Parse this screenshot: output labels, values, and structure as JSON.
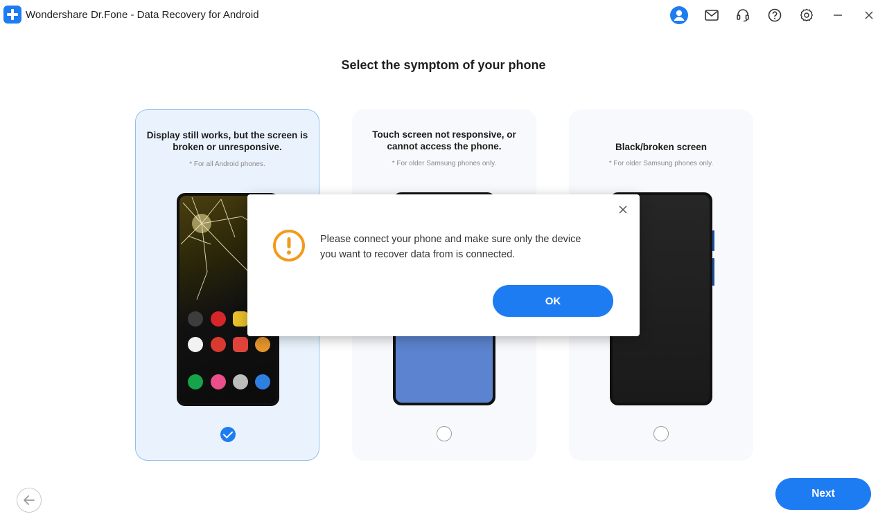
{
  "window": {
    "title": "Wondershare Dr.Fone - Data Recovery for Android",
    "icons": [
      "account-icon",
      "mail-icon",
      "headset-icon",
      "help-icon",
      "settings-icon",
      "minimize-icon",
      "close-icon"
    ]
  },
  "page": {
    "title": "Select the symptom of your phone"
  },
  "cards": [
    {
      "title": "Display still works, but the screen is broken or unresponsive.",
      "note": "* For all Android phones.",
      "selected": true
    },
    {
      "title": "Touch screen not responsive, or cannot access the phone.",
      "note": "* For older Samsung phones only.",
      "selected": false
    },
    {
      "title": "Black/broken screen",
      "note": "* For older Samsung phones only.",
      "selected": false
    }
  ],
  "modal": {
    "message": "Please connect your phone and make sure only the device you want to recover data from is connected.",
    "ok_label": "OK"
  },
  "footer": {
    "next_label": "Next"
  },
  "colors": {
    "accent": "#1e7cf2",
    "warning": "#f39a1c",
    "selected_card_bg": "#eaf3fd",
    "selected_card_border": "#8ec0ee"
  }
}
